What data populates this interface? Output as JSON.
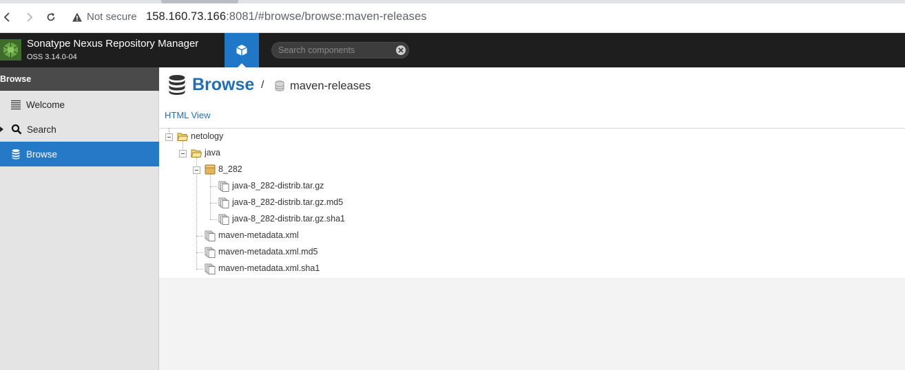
{
  "browser": {
    "security_label": "Not secure",
    "url_host": "158.160.73.166",
    "url_rest": ":8081/#browse/browse:maven-releases",
    "back_icon": "chevron-left-icon",
    "forward_icon": "chevron-right-icon",
    "reload_icon": "reload-icon"
  },
  "header": {
    "app_title": "Sonatype Nexus Repository Manager",
    "version": "OSS 3.14.0-04",
    "search_placeholder": "Search components",
    "accent_color": "#1f78c7"
  },
  "sidebar": {
    "title": "Browse",
    "items": [
      {
        "label": "Welcome",
        "icon": "list-icon",
        "active": false
      },
      {
        "label": "Search",
        "icon": "search-icon",
        "active": false
      },
      {
        "label": "Browse",
        "icon": "database-icon",
        "active": true
      }
    ]
  },
  "main": {
    "title": "Browse",
    "breadcrumb_sep": "/",
    "repository": "maven-releases",
    "html_view_link": "HTML View",
    "tree": [
      {
        "label": "netology",
        "type": "folder-open"
      },
      {
        "label": "java",
        "type": "folder-open"
      },
      {
        "label": "8_282",
        "type": "component"
      },
      {
        "label": "java-8_282-distrib.tar.gz",
        "type": "asset"
      },
      {
        "label": "java-8_282-distrib.tar.gz.md5",
        "type": "asset"
      },
      {
        "label": "java-8_282-distrib.tar.gz.sha1",
        "type": "asset"
      },
      {
        "label": "maven-metadata.xml",
        "type": "asset"
      },
      {
        "label": "maven-metadata.xml.md5",
        "type": "asset"
      },
      {
        "label": "maven-metadata.xml.sha1",
        "type": "asset"
      }
    ]
  }
}
